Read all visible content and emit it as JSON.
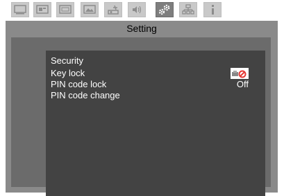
{
  "tabs": [
    {
      "icon": "display-icon",
      "active": false
    },
    {
      "icon": "image-adjust-icon",
      "active": false
    },
    {
      "icon": "screen-icon",
      "active": false
    },
    {
      "icon": "picture-icon",
      "active": false
    },
    {
      "icon": "installation-icon",
      "active": false
    },
    {
      "icon": "audio-icon",
      "active": false
    },
    {
      "icon": "setting-gear-icon",
      "active": true
    },
    {
      "icon": "network-icon",
      "active": false
    },
    {
      "icon": "info-icon",
      "active": false
    }
  ],
  "header": {
    "title": "Setting"
  },
  "menu": {
    "section": "Security",
    "items": [
      {
        "label": "Key lock",
        "value": "",
        "value_icon": "key-lock-off-icon"
      },
      {
        "label": "PIN code lock",
        "value": "Off"
      },
      {
        "label": "PIN code change",
        "value": ""
      }
    ]
  },
  "colors": {
    "tab_inactive": "#c9c9c9",
    "tab_active": "#7e7e7e",
    "panel": "#8a8a8a",
    "menu_bg": "#434343",
    "lock_badge": "#e53935"
  }
}
